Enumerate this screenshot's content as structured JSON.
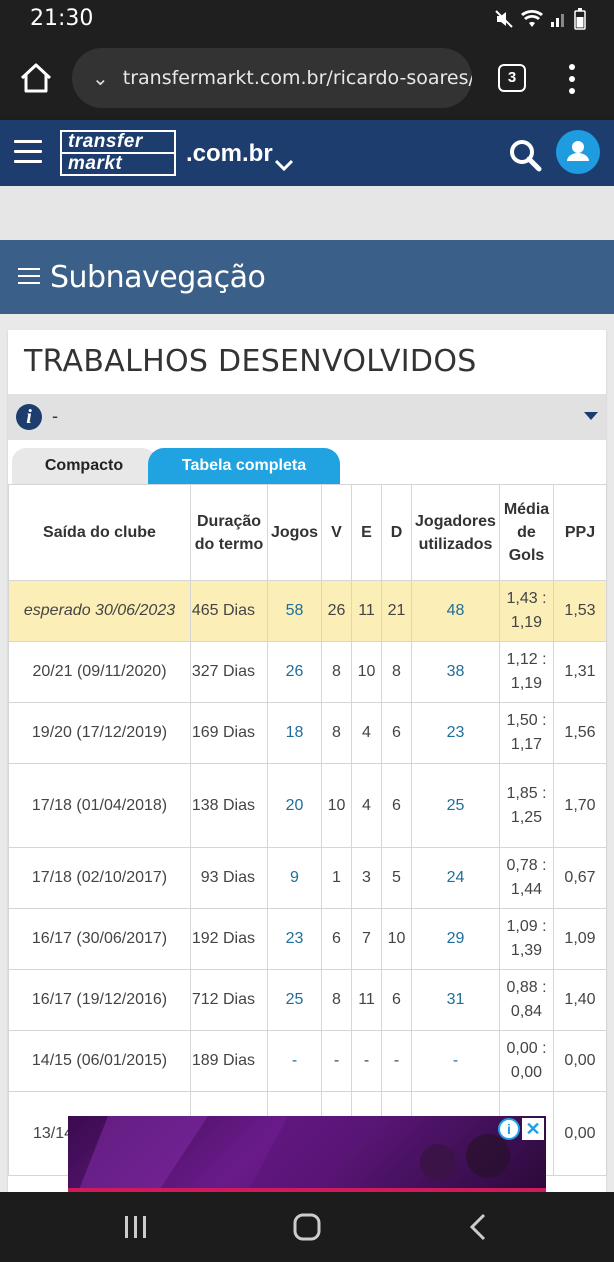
{
  "status": {
    "time": "21:30"
  },
  "browser": {
    "url": "transfermarkt.com.br/ricardo-soares/",
    "tab_count": "3"
  },
  "site": {
    "logo_line1": "transfer",
    "logo_line2": "markt",
    "domain": ".com.br"
  },
  "subnav": {
    "label": "Subnavegação"
  },
  "section": {
    "title": "TRABALHOS DESENVOLVIDOS",
    "filter_value": "-",
    "tabs": [
      {
        "label": "Compacto"
      },
      {
        "label": "Tabela completa"
      }
    ]
  },
  "table": {
    "headers": [
      "Saída do clube",
      "Duração do termo",
      "Jogos",
      "V",
      "E",
      "D",
      "Jogadores utilizados",
      "Média de Gols",
      "PPJ"
    ],
    "rows": [
      {
        "exit": "esperado 30/06/2023",
        "duration": "465 Dias",
        "games": "58",
        "w": "26",
        "d": "11",
        "l": "21",
        "players": "48",
        "avg": "1,43 : 1,19",
        "ppg": "1,53"
      },
      {
        "exit": "20/21 (09/11/2020)",
        "duration": "327 Dias",
        "games": "26",
        "w": "8",
        "d": "10",
        "l": "8",
        "players": "38",
        "avg": "1,12 : 1,19",
        "ppg": "1,31"
      },
      {
        "exit": "19/20 (17/12/2019)",
        "duration": "169 Dias",
        "games": "18",
        "w": "8",
        "d": "4",
        "l": "6",
        "players": "23",
        "avg": "1,50 : 1,17",
        "ppg": "1,56"
      },
      {
        "exit": "17/18 (01/04/2018)",
        "duration": "138 Dias",
        "games": "20",
        "w": "10",
        "d": "4",
        "l": "6",
        "players": "25",
        "avg": "1,85 : 1,25",
        "ppg": "1,70"
      },
      {
        "exit": "17/18 (02/10/2017)",
        "duration": "93 Dias",
        "games": "9",
        "w": "1",
        "d": "3",
        "l": "5",
        "players": "24",
        "avg": "0,78 : 1,44",
        "ppg": "0,67"
      },
      {
        "exit": "16/17 (30/06/2017)",
        "duration": "192 Dias",
        "games": "23",
        "w": "6",
        "d": "7",
        "l": "10",
        "players": "29",
        "avg": "1,09 : 1,39",
        "ppg": "1,09"
      },
      {
        "exit": "16/17 (19/12/2016)",
        "duration": "712 Dias",
        "games": "25",
        "w": "8",
        "d": "11",
        "l": "6",
        "players": "31",
        "avg": "0,88 : 0,84",
        "ppg": "1,40"
      },
      {
        "exit": "14/15 (06/01/2015)",
        "duration": "189 Dias",
        "games": "-",
        "w": "-",
        "d": "-",
        "l": "-",
        "players": "-",
        "avg": "0,00 : 0,00",
        "ppg": "0,00"
      },
      {
        "exit": "13/14",
        "duration": "",
        "games": "",
        "w": "",
        "d": "",
        "l": "",
        "players": "",
        "avg": "",
        "ppg": "0,00"
      }
    ]
  },
  "ad": {
    "info": "i",
    "close": "✕"
  },
  "colors": {
    "header_blue": "#1d3d6e",
    "subnav_blue": "#3a5f88",
    "accent": "#20a3e0",
    "highlight_row": "#fbeeb6",
    "link": "#1f6e9a"
  }
}
